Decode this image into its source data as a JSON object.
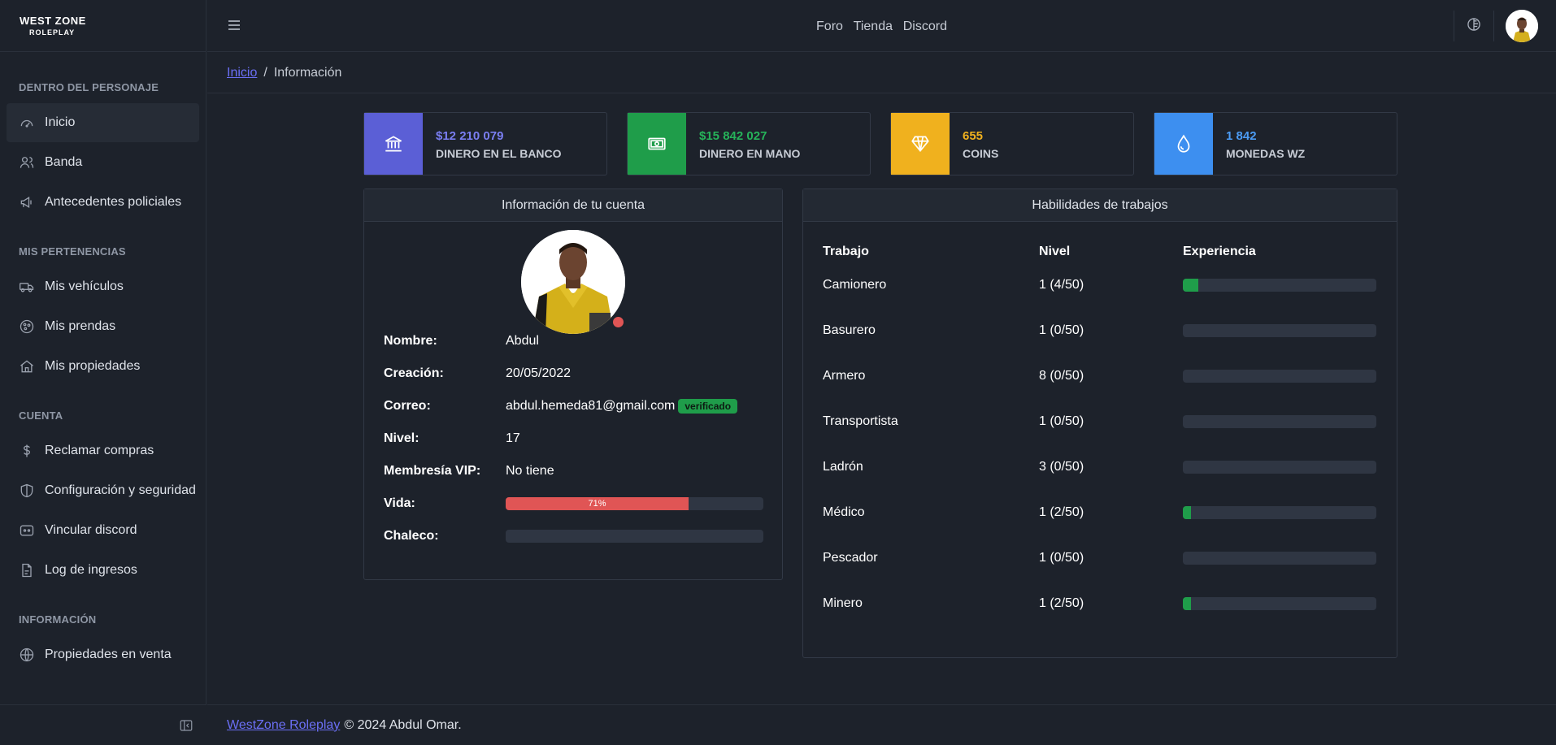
{
  "brand": {
    "line1": "WEST ZONE",
    "line2": "ROLEPLAY"
  },
  "sidebar": {
    "sections": [
      {
        "title": "DENTRO DEL PERSONAJE",
        "items": [
          {
            "label": "Inicio",
            "icon": "dashboard-icon",
            "active": true
          },
          {
            "label": "Banda",
            "icon": "users-icon"
          },
          {
            "label": "Antecedentes policiales",
            "icon": "megaphone-icon"
          }
        ]
      },
      {
        "title": "MIS PERTENENCIAS",
        "items": [
          {
            "label": "Mis vehículos",
            "icon": "truck-icon"
          },
          {
            "label": "Mis prendas",
            "icon": "shirt-icon"
          },
          {
            "label": "Mis propiedades",
            "icon": "home-icon"
          }
        ]
      },
      {
        "title": "CUENTA",
        "items": [
          {
            "label": "Reclamar compras",
            "icon": "dollar-icon"
          },
          {
            "label": "Configuración y seguridad",
            "icon": "shield-icon"
          },
          {
            "label": "Vincular discord",
            "icon": "discord-icon"
          },
          {
            "label": "Log de ingresos",
            "icon": "file-icon"
          }
        ]
      },
      {
        "title": "INFORMACIÓN",
        "items": [
          {
            "label": "Propiedades en venta",
            "icon": "globe-icon"
          }
        ]
      }
    ]
  },
  "header": {
    "links": [
      "Foro",
      "Tienda",
      "Discord"
    ]
  },
  "breadcrumb": {
    "home": "Inicio",
    "separator": "/",
    "current": "Información"
  },
  "stats": [
    {
      "value": "$12 210 079",
      "label": "DINERO EN EL BANCO",
      "color": "#5b5fd6",
      "value_color": "#7a7ef2",
      "icon": "bank-icon"
    },
    {
      "value": "$15 842 027",
      "label": "DINERO EN MANO",
      "color": "#1f9d4a",
      "value_color": "#26b35a",
      "icon": "cash-icon"
    },
    {
      "value": "655",
      "label": "COINS",
      "color": "#f0b11e",
      "value_color": "#f0b11e",
      "icon": "diamond-icon"
    },
    {
      "value": "1 842",
      "label": "MONEDAS WZ",
      "color": "#3d8ff0",
      "value_color": "#4c9cf5",
      "icon": "drop-icon"
    }
  ],
  "account": {
    "title": "Información de tu cuenta",
    "rows": [
      {
        "label": "Nombre:",
        "value": "Abdul"
      },
      {
        "label": "Creación:",
        "value": "20/05/2022"
      },
      {
        "label": "Correo:",
        "value": "abdul.hemeda81@gmail.com",
        "badge": "verificado"
      },
      {
        "label": "Nivel:",
        "value": "17"
      },
      {
        "label": "Membresía VIP:",
        "value": "No tiene"
      }
    ],
    "vida": {
      "label": "Vida:",
      "percent": 71,
      "text": "71%"
    },
    "chaleco": {
      "label": "Chaleco:",
      "percent": 0
    }
  },
  "jobs": {
    "title": "Habilidades de trabajos",
    "headers": [
      "Trabajo",
      "Nivel",
      "Experiencia"
    ],
    "rows": [
      {
        "name": "Camionero",
        "level": "1 (4/50)",
        "exp": 8
      },
      {
        "name": "Basurero",
        "level": "1 (0/50)",
        "exp": 0
      },
      {
        "name": "Armero",
        "level": "8 (0/50)",
        "exp": 0
      },
      {
        "name": "Transportista",
        "level": "1 (0/50)",
        "exp": 0
      },
      {
        "name": "Ladrón",
        "level": "3 (0/50)",
        "exp": 0
      },
      {
        "name": "Médico",
        "level": "1 (2/50)",
        "exp": 4
      },
      {
        "name": "Pescador",
        "level": "1 (0/50)",
        "exp": 0
      },
      {
        "name": "Minero",
        "level": "1 (2/50)",
        "exp": 4
      }
    ]
  },
  "footer": {
    "link": "WestZone Roleplay",
    "text": "© 2024 Abdul Omar."
  }
}
